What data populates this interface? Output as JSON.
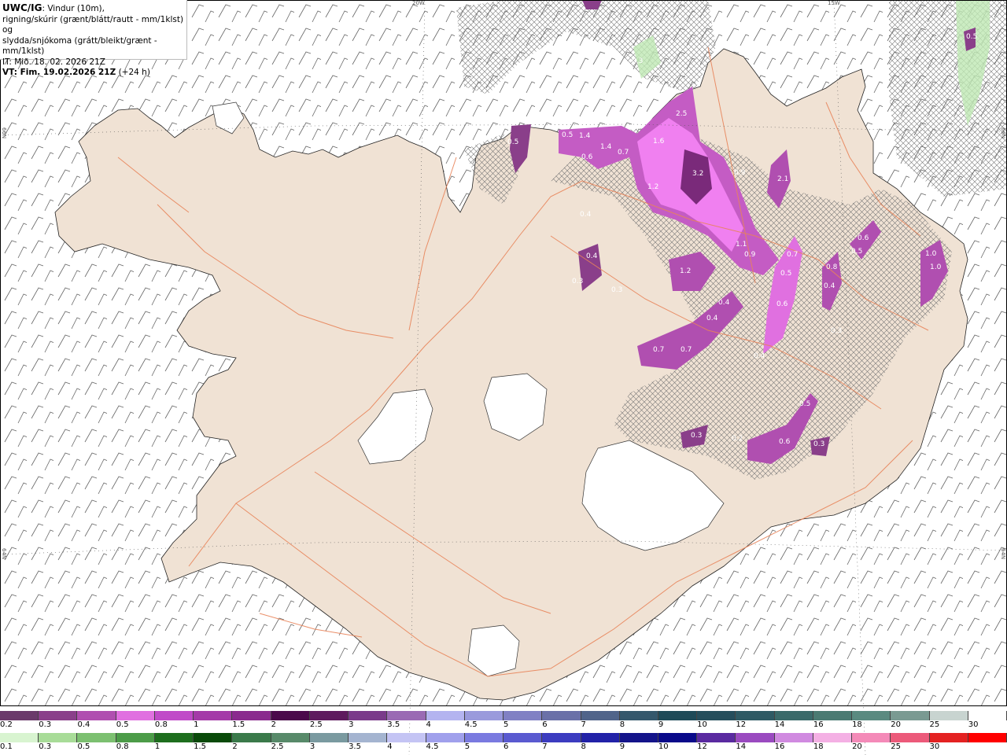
{
  "header": {
    "model": "UWC/IG",
    "line1_rest": ": Vindur (10m),",
    "line2": "rigning/skúrir (grænt/blátt/rautt - mm/1klst) og",
    "line3": "slydda/snjókoma (grátt/bleikt/grænt - mm/1klst)",
    "line4": "IT: Mið. 18. 02. 2026 21Z",
    "line5_bold": "VT: Fim. 19.02.2026 21Z",
    "line5_rest": " (+24 h)"
  },
  "grid_labels": {
    "lon_20w": "20W",
    "lon_15w": "15W",
    "lat_66n_left": "66N",
    "lat_66n_right": "66N",
    "lat_64n_left": "64N",
    "lat_64n_right": "64N"
  },
  "precip_labels": [
    "2.5",
    "3.2",
    "1.6",
    "1.2",
    "1.1",
    "0.9",
    "0.7",
    "0.5",
    "0.6",
    "0.4",
    "0.3",
    "2.1",
    "1.0",
    "0.2",
    "0.8",
    "1.4"
  ],
  "colorbar_snow": {
    "labels": [
      "0.2",
      "0.3",
      "0.4",
      "0.5",
      "0.8",
      "1",
      "1.5",
      "2",
      "2.5",
      "3",
      "3.5",
      "4",
      "4.5",
      "5",
      "6",
      "7",
      "8",
      "9",
      "10",
      "12",
      "14",
      "16",
      "18",
      "20",
      "25",
      "30"
    ],
    "colors": [
      "#6b3a6b",
      "#8a3f8a",
      "#b04fb0",
      "#e070e0",
      "#c04ac8",
      "#a43aa8",
      "#8a2a8e",
      "#4a0a4a",
      "#5e1a5e",
      "#7a3a8a",
      "#9a6ab4",
      "#b4b4f0",
      "#9a9adc",
      "#8080c4",
      "#6a70a8",
      "#50648a",
      "#34586c",
      "#1e4a58",
      "#254e5c",
      "#2e5a64",
      "#3a6a6a",
      "#4a7a72",
      "#5a8a80",
      "#7a9a92",
      "#c8d4d0",
      "#ffffff"
    ]
  },
  "colorbar_rain": {
    "labels": [
      "0.1",
      "0.3",
      "0.5",
      "0.8",
      "1",
      "1.5",
      "2",
      "2.5",
      "3",
      "3.5",
      "4",
      "4.5",
      "5",
      "6",
      "7",
      "8",
      "9",
      "10",
      "12",
      "14",
      "16",
      "18",
      "20",
      "25",
      "30"
    ],
    "colors": [
      "#d8f4d0",
      "#a8dc98",
      "#7cc070",
      "#4c9c48",
      "#1e6e1e",
      "#0a4a0a",
      "#3a7a4a",
      "#588a6a",
      "#7a9aa0",
      "#a4b4d0",
      "#c4c4f4",
      "#a0a0ec",
      "#7a7ae0",
      "#5a5ad0",
      "#3c3cc0",
      "#2222a8",
      "#14148a",
      "#0a0a8a",
      "#5a2aa0",
      "#9a4ac0",
      "#d08ae0",
      "#f4b0e4",
      "#f48ab8",
      "#ec5a7a",
      "#e42222",
      "#ff0000"
    ]
  }
}
